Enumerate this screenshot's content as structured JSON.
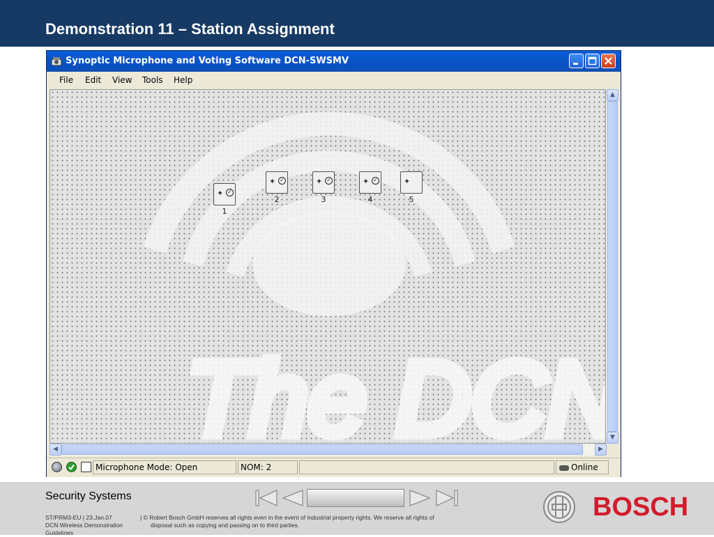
{
  "slide": {
    "title": "Demonstration 11 – Station Assignment"
  },
  "window": {
    "title": "Synoptic Microphone and Voting Software DCN-SWSMV",
    "icon": "microphone-app-icon",
    "controls": [
      "minimize",
      "maximize",
      "close"
    ]
  },
  "menu": {
    "items": [
      "File",
      "Edit",
      "View",
      "Tools",
      "Help"
    ]
  },
  "canvas": {
    "watermark_text": "The DCN",
    "stations": [
      {
        "number": "1",
        "checked": true
      },
      {
        "number": "2",
        "checked": true
      },
      {
        "number": "3",
        "checked": true
      },
      {
        "number": "4",
        "checked": true
      },
      {
        "number": "5",
        "checked": false
      }
    ]
  },
  "statusbar": {
    "icons": [
      "globe-icon",
      "check-icon",
      "document-icon"
    ],
    "mode": "Microphone Mode: Open",
    "nom": "NOM: 2",
    "connection": "Online"
  },
  "footer": {
    "brand": "Security Systems",
    "doc_id": "ST/PRM3-EU",
    "date": "23.Jan.07",
    "doc_title_line1": "DCN Wireless Demonstration",
    "doc_title_line2": "Guidelines",
    "copyright_line1": "| © Robert Bosch GmbH reserves all rights even in the event of industrial property rights. We reserve all rights of",
    "copyright_line2": "disposal such as copying and passing on to third parties.",
    "logo": "BOSCH"
  },
  "colors": {
    "header": "#173a64",
    "bosch_red": "#d21b2c",
    "xp_title": "#0a5fd8"
  }
}
